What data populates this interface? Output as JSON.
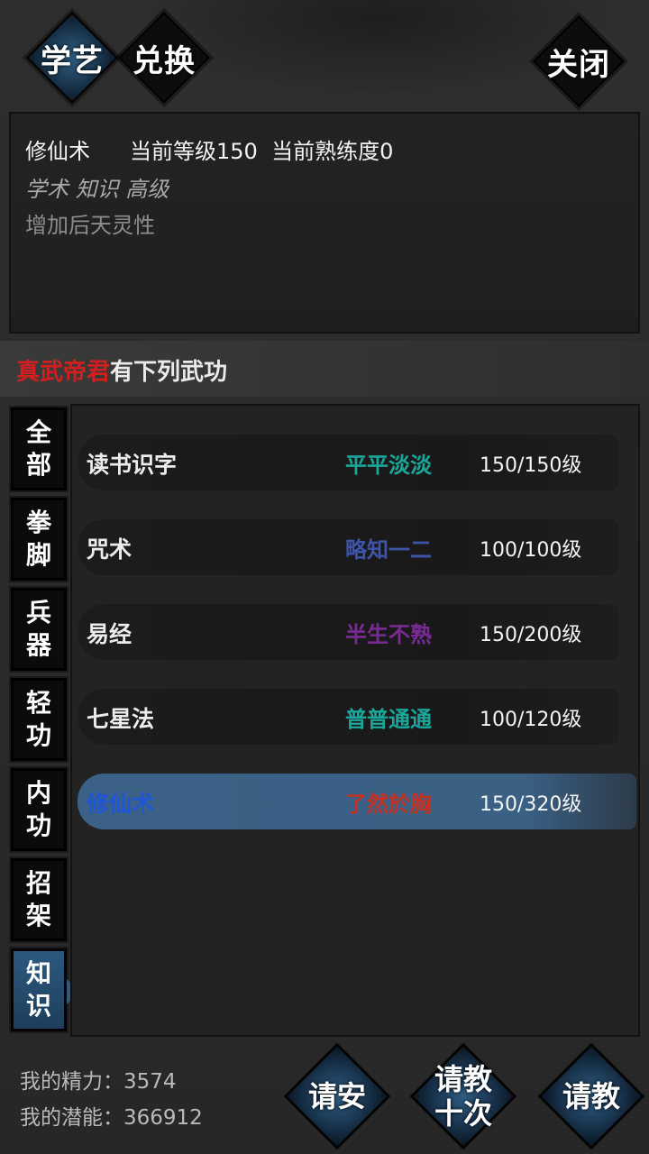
{
  "tabs": {
    "xueyi": "学艺",
    "duihuan": "兑换",
    "close": "关闭"
  },
  "info": {
    "name": "修仙术",
    "current_level": "当前等级150",
    "current_proficiency": "当前熟练度0",
    "tags": "学术 知识 高级",
    "description": "增加后天灵性"
  },
  "master": {
    "name": "真武帝君",
    "suffix": "有下列武功"
  },
  "categories": [
    {
      "line1": "全",
      "line2": "部"
    },
    {
      "line1": "拳",
      "line2": "脚"
    },
    {
      "line1": "兵",
      "line2": "器"
    },
    {
      "line1": "轻",
      "line2": "功"
    },
    {
      "line1": "内",
      "line2": "功"
    },
    {
      "line1": "招",
      "line2": "架"
    },
    {
      "line1": "知",
      "line2": "识"
    }
  ],
  "active_category": 6,
  "skills": [
    {
      "name": "读书识字",
      "rank": "平平淡淡",
      "rank_color": "#1aa79a",
      "level": "150/150级"
    },
    {
      "name": "咒术",
      "rank": "略知一二",
      "rank_color": "#3d55a8",
      "level": "100/100级"
    },
    {
      "name": "易经",
      "rank": "半生不熟",
      "rank_color": "#7a2a95",
      "level": "150/200级"
    },
    {
      "name": "七星法",
      "rank": "普普通通",
      "rank_color": "#1aa79a",
      "level": "100/120级"
    },
    {
      "name": "修仙术",
      "rank": "了然於胸",
      "rank_color": "#c23325",
      "level": "150/320级"
    }
  ],
  "selected_skill": 4,
  "stats": {
    "jingli": "我的精力：3574",
    "qianneng": "我的潜能：366912"
  },
  "actions": {
    "qingan": "请安",
    "qingjiao10_line1": "请教",
    "qingjiao10_line2": "十次",
    "qingjiao": "请教"
  }
}
